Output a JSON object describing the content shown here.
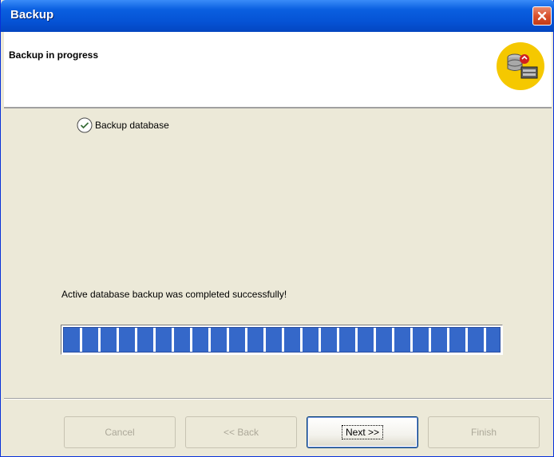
{
  "window": {
    "title": "Backup"
  },
  "header": {
    "title": "Backup in progress",
    "icon": "database-backup-icon"
  },
  "task": {
    "label": "Backup database",
    "icon": "check-circle-icon",
    "status": "completed"
  },
  "status_message": "Active database  backup was completed successfully!",
  "progress": {
    "fraction": 1.0
  },
  "buttons": {
    "cancel": "Cancel",
    "back": "<< Back",
    "next": "Next >>",
    "finish": "Finish"
  },
  "colors": {
    "titlebar": "#0552d4",
    "progress": "#3568c9",
    "close": "#d9512d"
  }
}
